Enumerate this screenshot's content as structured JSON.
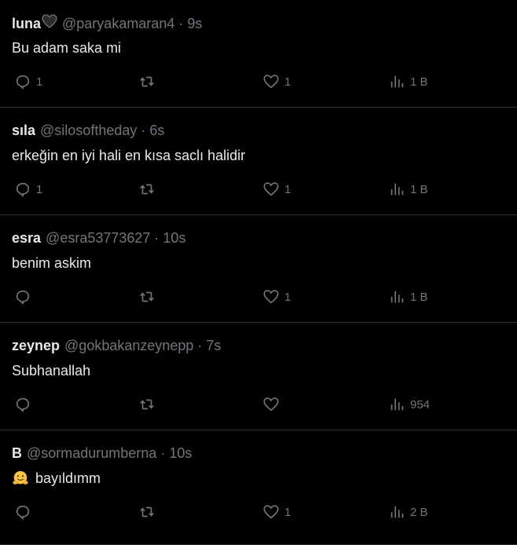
{
  "tweets": [
    {
      "name": "luna",
      "has_heart_badge": true,
      "handle": "@paryakamaran4",
      "time": "9s",
      "text": "Bu adam saka mi",
      "replies": "1",
      "likes": "1",
      "views": "1 B"
    },
    {
      "name": "sıla",
      "handle": "@silosoftheday",
      "time": "6s",
      "text": "erkeğin en iyi hali en kısa saclı halidir",
      "replies": "1",
      "likes": "1",
      "views": "1 B"
    },
    {
      "name": "esra",
      "handle": "@esra53773627",
      "time": "10s",
      "text": "benim askim",
      "replies": "",
      "likes": "1",
      "views": "1 B"
    },
    {
      "name": "zeynep",
      "handle": "@gokbakanzeynepp",
      "time": "7s",
      "text": "Subhanallah",
      "replies": "",
      "likes": "",
      "views": "954"
    },
    {
      "name": "B",
      "handle": "@sormadurumberna",
      "time": "10s",
      "emoji": "hugging-face-emoji",
      "text": "bayıldımm",
      "replies": "",
      "likes": "1",
      "views": "2 B"
    }
  ],
  "separator": "·",
  "colors": {
    "background": "#000000",
    "primary_text": "#e7e9ea",
    "secondary_text": "#71767b",
    "divider": "#2f3336"
  }
}
